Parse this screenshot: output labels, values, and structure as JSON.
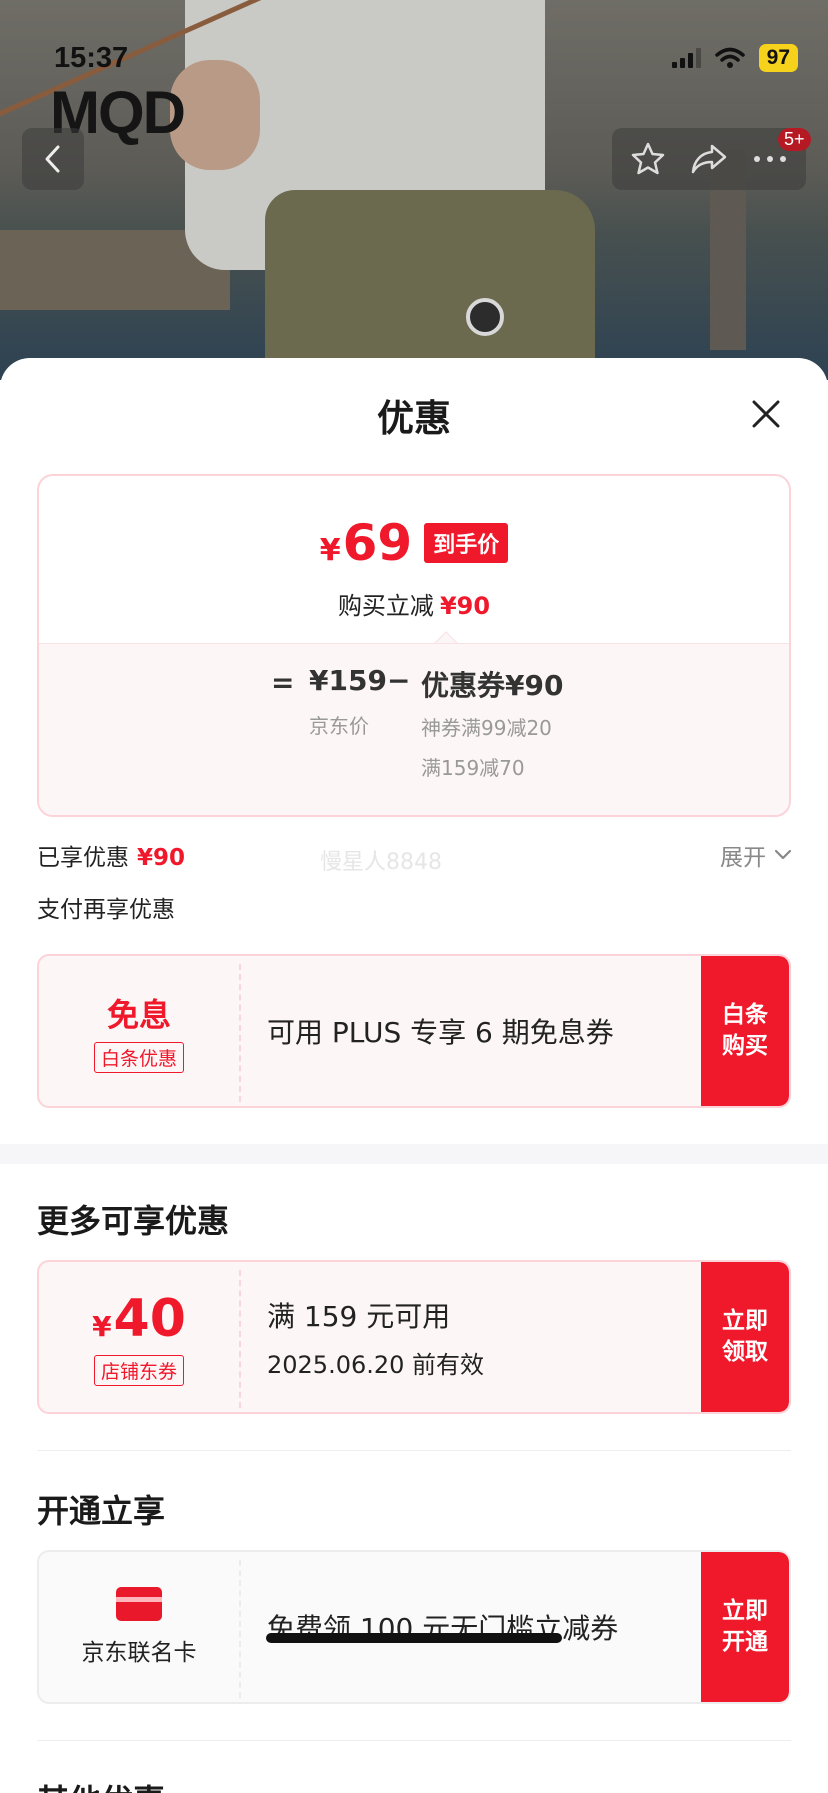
{
  "status_bar": {
    "time": "15:37",
    "battery": "97"
  },
  "brand": {
    "logo_text": "MQD"
  },
  "nav": {
    "badge": "5+"
  },
  "icons": [
    "back-icon",
    "star-icon",
    "share-icon",
    "more-icon",
    "close-icon",
    "chevron-down-icon",
    "card-icon"
  ],
  "colors": {
    "accent": "#f0182b",
    "coupon_bg": "#fdf6f7",
    "coupon_border": "#fbd3d9"
  },
  "sheet": {
    "title": "优惠"
  },
  "price_card": {
    "final_symbol": "¥",
    "final_price": "69",
    "final_tag": "到手价",
    "reduce_text": "购买立减",
    "reduce_amount": "¥90",
    "equals": "=",
    "jd_price": "¥159",
    "jd_label": "京东价",
    "minus": "−",
    "coupon_total": "优惠券¥90",
    "coupon_detail_1": "神券满99减20",
    "coupon_detail_2": "满159减70"
  },
  "enjoyed": {
    "label": "已享优惠",
    "amount": "¥90",
    "expand": "展开"
  },
  "watermark": "慢星人8848",
  "pay_more": {
    "label": "支付再享优惠"
  },
  "baitiao": {
    "title": "免息",
    "tag": "白条优惠",
    "desc": "可用 PLUS 专享 6 期免息券",
    "cta": "白条\n购买"
  },
  "more": {
    "title": "更多可享优惠",
    "coupon": {
      "symbol": "¥",
      "amount": "40",
      "tag": "店铺东券",
      "condition": "满 159 元可用",
      "expiry": "2025.06.20 前有效",
      "cta": "立即\n领取"
    }
  },
  "open": {
    "title": "开通立享",
    "card": {
      "name": "京东联名卡",
      "desc": "免费领 100 元无门槛立减券",
      "cta": "立即\n开通"
    }
  },
  "other": {
    "title": "其他优惠"
  }
}
